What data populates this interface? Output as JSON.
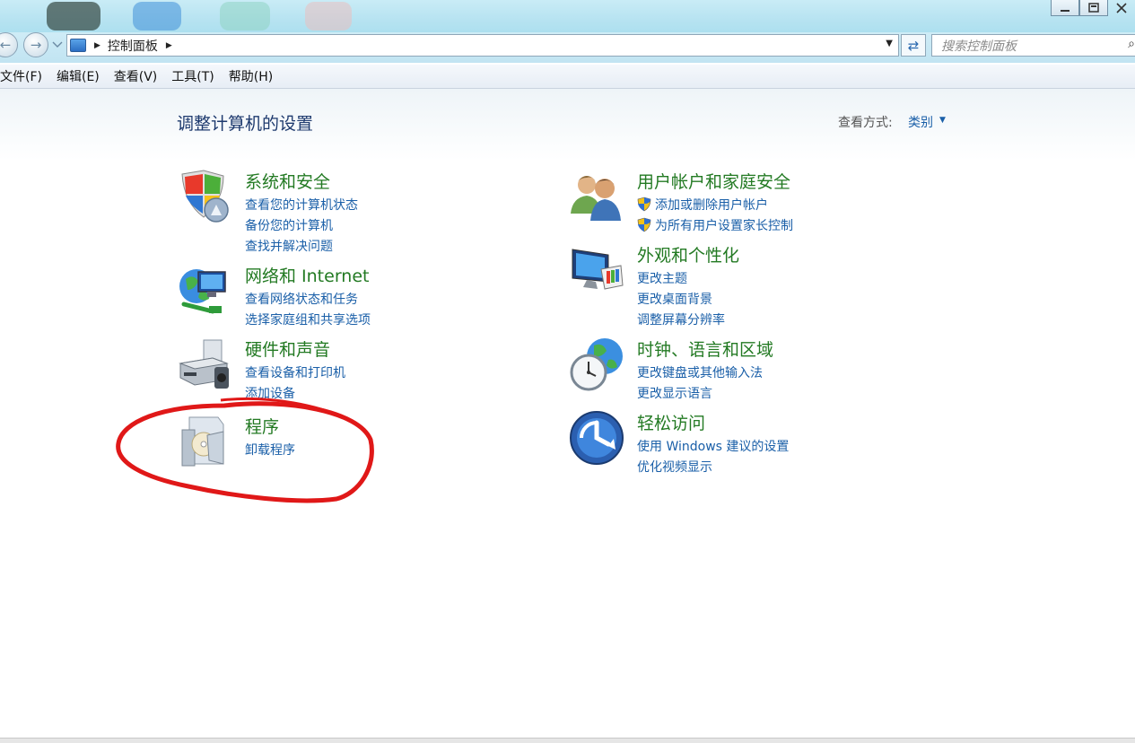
{
  "nav": {
    "breadcrumb": "控制面板",
    "search_placeholder": "搜索控制面板"
  },
  "menu": [
    "文件(F)",
    "编辑(E)",
    "查看(V)",
    "工具(T)",
    "帮助(H)"
  ],
  "main": {
    "title": "调整计算机的设置",
    "view_label": "查看方式:",
    "view_value": "类别"
  },
  "categories": [
    {
      "title": "系统和安全",
      "icon": "shield-icon",
      "links": [
        "查看您的计算机状态",
        "备份您的计算机",
        "查找并解决问题"
      ]
    },
    {
      "title": "网络和 Internet",
      "icon": "network-globe-icon",
      "links": [
        "查看网络状态和任务",
        "选择家庭组和共享选项"
      ]
    },
    {
      "title": "硬件和声音",
      "icon": "printer-icon",
      "links": [
        "查看设备和打印机",
        "添加设备"
      ]
    },
    {
      "title": "程序",
      "icon": "programs-disc-icon",
      "links": [
        "卸载程序"
      ]
    },
    {
      "title": "用户帐户和家庭安全",
      "icon": "users-icon",
      "links": [
        "添加或删除用户帐户",
        "为所有用户设置家长控制"
      ]
    },
    {
      "title": "外观和个性化",
      "icon": "monitor-palette-icon",
      "links": [
        "更改主题",
        "更改桌面背景",
        "调整屏幕分辨率"
      ]
    },
    {
      "title": "时钟、语言和区域",
      "icon": "clock-globe-icon",
      "links": [
        "更改键盘或其他输入法",
        "更改显示语言"
      ]
    },
    {
      "title": "轻松访问",
      "icon": "ease-of-access-icon",
      "links": [
        "使用 Windows 建议的设置",
        "优化视频显示"
      ]
    }
  ],
  "annotation": {
    "color": "#e01818"
  }
}
